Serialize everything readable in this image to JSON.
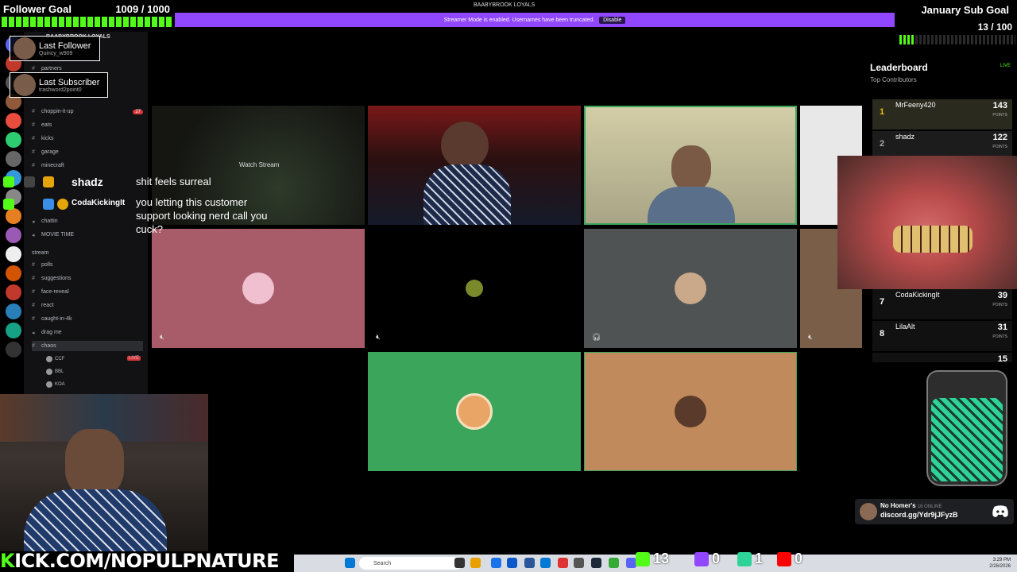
{
  "follower_goal": {
    "label": "Follower Goal",
    "count": "1009 / 1000"
  },
  "sub_goal": {
    "label": "January Sub Goal",
    "count": "13 / 100",
    "progress": 0.13
  },
  "discord": {
    "server_title": "BAABYBROOK LOYALS",
    "banner_text": "Streamer Mode is enabled. Usernames have been truncated.",
    "banner_button": "Disable",
    "guild_name": "BAABYBROOK LOYALS",
    "channels": [
      {
        "name": "partners",
        "badge": ""
      },
      {
        "name": "choppin-it-up",
        "badge": "27"
      },
      {
        "name": "eats",
        "badge": ""
      },
      {
        "name": "kicks",
        "badge": ""
      },
      {
        "name": "garage",
        "badge": ""
      },
      {
        "name": "minecraft",
        "badge": ""
      },
      {
        "name": "chattin",
        "badge": ""
      },
      {
        "name": "MOVIE TIME",
        "badge": ""
      },
      {
        "name": "stream",
        "badge": ""
      },
      {
        "name": "polls",
        "badge": ""
      },
      {
        "name": "suggestions",
        "badge": ""
      },
      {
        "name": "face-reveal",
        "badge": ""
      },
      {
        "name": "react",
        "badge": ""
      },
      {
        "name": "caught-in-4k",
        "badge": ""
      },
      {
        "name": "drag me",
        "badge": ""
      },
      {
        "name": "chaos",
        "badge": ""
      }
    ],
    "voice_users": [
      "CCF",
      "BBL",
      "KOA"
    ],
    "live_label": "LIVE"
  },
  "last_follower": {
    "title": "Last Follower",
    "name": "Quincy_w909"
  },
  "last_subscriber": {
    "title": "Last Subscriber",
    "name": "trashword2point0"
  },
  "chat": [
    {
      "user": "shadz",
      "message": "shit feels surreal"
    },
    {
      "user": "CodaKickingIt",
      "message": "you letting this customer support looking nerd call you cuck?"
    }
  ],
  "watch_stream_label": "Watch Stream",
  "leaderboard": {
    "title": "Leaderboard",
    "subtitle": "Top Contributors",
    "live": "LIVE",
    "points_label": "POINTS",
    "rows": [
      {
        "rank": "1",
        "name": "MrFeeny420",
        "points": "143"
      },
      {
        "rank": "2",
        "name": "shadz",
        "points": "122"
      },
      {
        "rank": "7",
        "name": "CodaKickingIt",
        "points": "39"
      },
      {
        "rank": "8",
        "name": "LilaAlt",
        "points": "31"
      },
      {
        "rank": "",
        "name": "",
        "points": "15"
      }
    ]
  },
  "invite": {
    "name": "No Homer's",
    "online": "16 ONLINE",
    "url": "discord.gg/Ydr9jJFyzB"
  },
  "kick_url": {
    "prefix": "K",
    "rest": "ICK.COM/NOPULPNATURE"
  },
  "taskbar": {
    "search_placeholder": "Search",
    "counts": {
      "kick": "13",
      "twitch": "0",
      "kick2": "1",
      "youtube": "0"
    },
    "time": "3:29 PM",
    "date": "2/26/2026"
  },
  "colors": {
    "kick_green": "#53fc18",
    "discord_purple": "#9146ff",
    "talking_border": "#3ba55c"
  }
}
